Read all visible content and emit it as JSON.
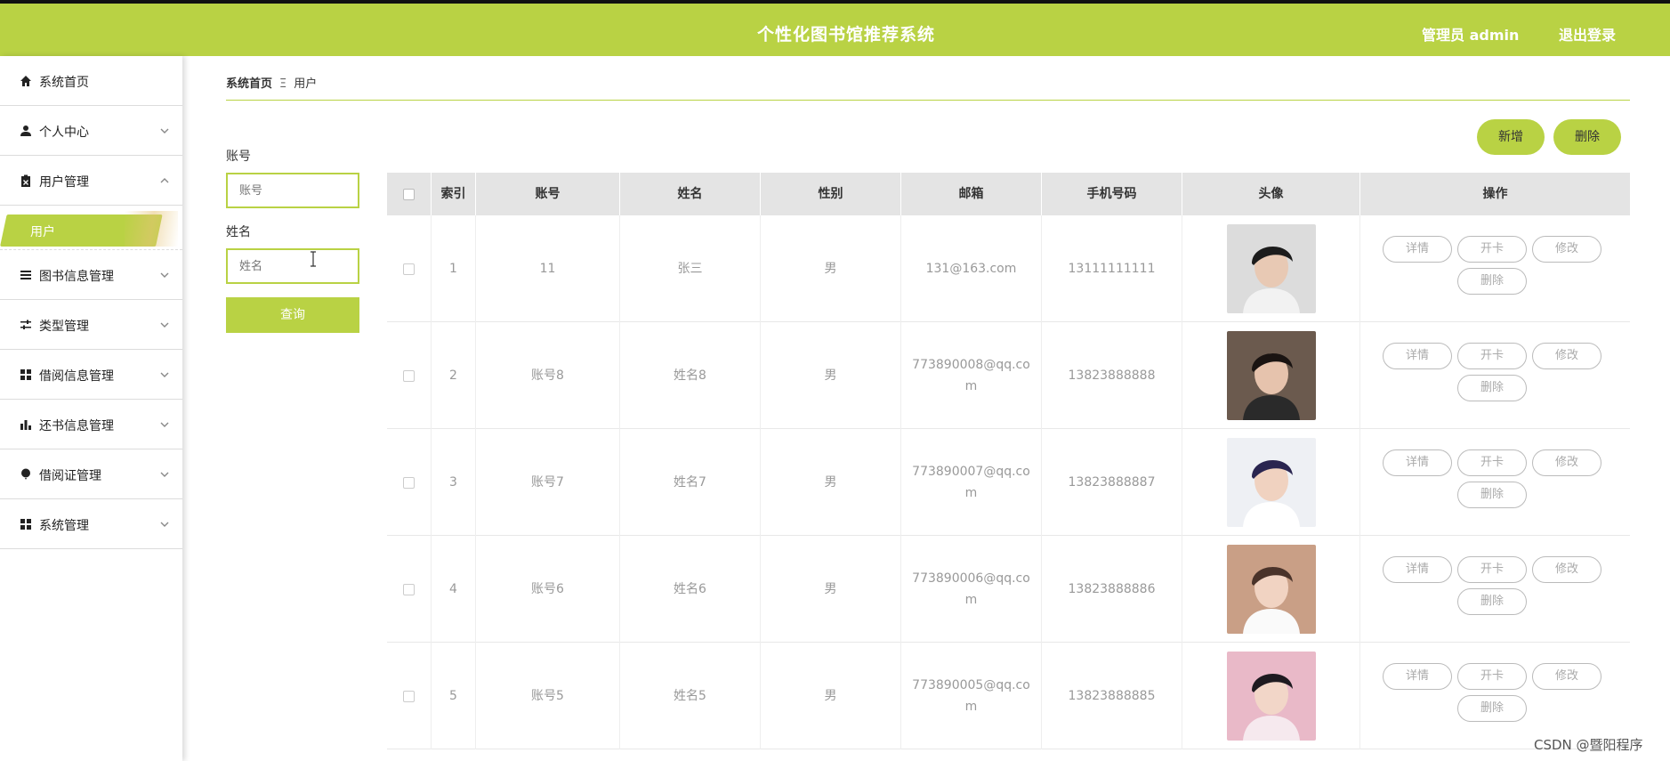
{
  "header": {
    "title": "个性化图书馆推荐系统",
    "admin": "管理员 admin",
    "logout": "退出登录"
  },
  "sidebar": {
    "items": [
      {
        "label": "系统首页",
        "icon": "home-icon"
      },
      {
        "label": "个人中心",
        "icon": "user-icon"
      },
      {
        "label": "用户管理",
        "icon": "clipboard-icon",
        "expanded": true,
        "sub": [
          "用户"
        ]
      },
      {
        "label": "图书信息管理",
        "icon": "list-icon"
      },
      {
        "label": "类型管理",
        "icon": "sliders-icon"
      },
      {
        "label": "借阅信息管理",
        "icon": "grid-icon"
      },
      {
        "label": "还书信息管理",
        "icon": "bar-chart-icon"
      },
      {
        "label": "借阅证管理",
        "icon": "balloon-icon"
      },
      {
        "label": "系统管理",
        "icon": "grid-icon"
      }
    ]
  },
  "breadcrumb": {
    "home": "系统首页",
    "sep": "Ξ",
    "current": "用户"
  },
  "actions": {
    "add": "新增",
    "delete": "删除"
  },
  "search": {
    "account_label": "账号",
    "account_placeholder": "账号",
    "name_label": "姓名",
    "name_placeholder": "姓名",
    "query": "查询"
  },
  "table": {
    "headers": [
      "索引",
      "账号",
      "姓名",
      "性别",
      "邮箱",
      "手机号码",
      "头像",
      "操作"
    ],
    "rows": [
      {
        "index": "1",
        "account": "11",
        "name": "张三",
        "gender": "男",
        "email": "131@163.com",
        "phone": "13111111111"
      },
      {
        "index": "2",
        "account": "账号8",
        "name": "姓名8",
        "gender": "男",
        "email": "773890008@qq.co\nm",
        "phone": "13823888888"
      },
      {
        "index": "3",
        "account": "账号7",
        "name": "姓名7",
        "gender": "男",
        "email": "773890007@qq.co\nm",
        "phone": "13823888887"
      },
      {
        "index": "4",
        "account": "账号6",
        "name": "姓名6",
        "gender": "男",
        "email": "773890006@qq.co\nm",
        "phone": "13823888886"
      },
      {
        "index": "5",
        "account": "账号5",
        "name": "姓名5",
        "gender": "男",
        "email": "773890005@qq.co\nm",
        "phone": "13823888885"
      }
    ],
    "ops": {
      "detail": "详情",
      "card": "开卡",
      "edit": "修改",
      "delete": "删除"
    }
  },
  "watermark": "CSDN @暨阳程序",
  "colors": {
    "accent": "#b9d244",
    "header_bg": "#b9d244",
    "table_head": "#e4e4e4"
  }
}
